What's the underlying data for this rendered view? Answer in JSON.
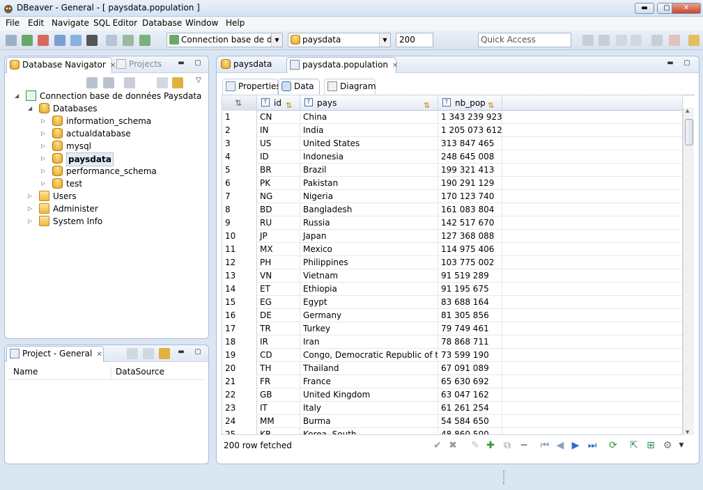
{
  "window": {
    "title": "DBeaver - General - [ paysdata.population ]",
    "min": "▬",
    "max": "▢",
    "close": "✕"
  },
  "menu": [
    "File",
    "Edit",
    "Navigate",
    "SQL Editor",
    "Database",
    "Window",
    "Help"
  ],
  "toolbar": {
    "connection": "Connection base de dor",
    "database": "paysdata",
    "max_rows": "200",
    "quick_access": "Quick Access"
  },
  "navigator": {
    "tab_active": "Database Navigator",
    "tab_other": "Projects",
    "connection": "Connection base de données Paysdata",
    "databases_label": "Databases",
    "databases": [
      "information_schema",
      "actualdatabase",
      "mysql",
      "paysdata",
      "performance_schema",
      "test"
    ],
    "selected": "paysdata",
    "folders": [
      "Users",
      "Administer",
      "System Info"
    ]
  },
  "project": {
    "title": "Project - General",
    "col_name": "Name",
    "col_datasource": "DataSource"
  },
  "editor": {
    "tabs": [
      "paysdata",
      "paysdata.population"
    ],
    "subtabs": [
      "Properties",
      "Data",
      "Diagram"
    ],
    "columns": [
      "id",
      "pays",
      "nb_pop"
    ],
    "rows": [
      [
        "1",
        "CN",
        "China",
        "1 343 239 923"
      ],
      [
        "2",
        "IN",
        "India",
        "1 205 073 612"
      ],
      [
        "3",
        "US",
        "United States",
        "313 847 465"
      ],
      [
        "4",
        "ID",
        "Indonesia",
        "248 645 008"
      ],
      [
        "5",
        "BR",
        "Brazil",
        "199 321 413"
      ],
      [
        "6",
        "PK",
        "Pakistan",
        "190 291 129"
      ],
      [
        "7",
        "NG",
        "Nigeria",
        "170 123 740"
      ],
      [
        "8",
        "BD",
        "Bangladesh",
        "161 083 804"
      ],
      [
        "9",
        "RU",
        "Russia",
        "142 517 670"
      ],
      [
        "10",
        "JP",
        "Japan",
        "127 368 088"
      ],
      [
        "11",
        "MX",
        "Mexico",
        "114 975 406"
      ],
      [
        "12",
        "PH",
        "Philippines",
        "103 775 002"
      ],
      [
        "13",
        "VN",
        "Vietnam",
        "91 519 289"
      ],
      [
        "14",
        "ET",
        "Ethiopia",
        "91 195 675"
      ],
      [
        "15",
        "EG",
        "Egypt",
        "83 688 164"
      ],
      [
        "16",
        "DE",
        "Germany",
        "81 305 856"
      ],
      [
        "17",
        "TR",
        "Turkey",
        "79 749 461"
      ],
      [
        "18",
        "IR",
        "Iran",
        "78 868 711"
      ],
      [
        "19",
        "CD",
        "Congo, Democratic Republic of the",
        "73 599 190"
      ],
      [
        "20",
        "TH",
        "Thailand",
        "67 091 089"
      ],
      [
        "21",
        "FR",
        "France",
        "65 630 692"
      ],
      [
        "22",
        "GB",
        "United Kingdom",
        "63 047 162"
      ],
      [
        "23",
        "IT",
        "Italy",
        "61 261 254"
      ],
      [
        "24",
        "MM",
        "Burma",
        "54 584 650"
      ],
      [
        "25",
        "KR",
        "Korea, South",
        "48 860 500"
      ]
    ],
    "status": "200 row fetched"
  },
  "icons": {
    "table_type": "T",
    "sort": "⇅"
  },
  "colors": {
    "selection": "#cde0f7",
    "accent": "#3a6ea5"
  }
}
